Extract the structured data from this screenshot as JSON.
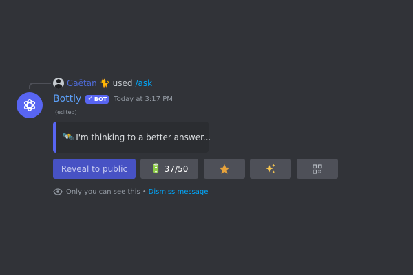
{
  "reply": {
    "username": "Gaëtan",
    "emoji": "🐈",
    "used_text": "used",
    "command": "/ask"
  },
  "message": {
    "username": "Bottly",
    "bot_tag_check": "✓",
    "bot_tag_label": "BOT",
    "timestamp": "Today at 3:17 PM",
    "edited_label": "(edited)"
  },
  "embed": {
    "icon": "🛰️",
    "text": "I'm thinking to a better answer..."
  },
  "buttons": {
    "reveal_label": "Reveal to public",
    "counter_icon": "🔋",
    "counter_label": "37/50",
    "star_icon": "star-icon",
    "sparkle_icon": "sparkles-icon",
    "qr_icon": "qr-code-icon"
  },
  "ephemeral": {
    "text": "Only you can see this",
    "separator": "•",
    "dismiss_label": "Dismiss message"
  },
  "colors": {
    "background": "#313338",
    "blurple": "#5865f2",
    "link": "#00a8fc",
    "button_gray": "#4e5058"
  }
}
